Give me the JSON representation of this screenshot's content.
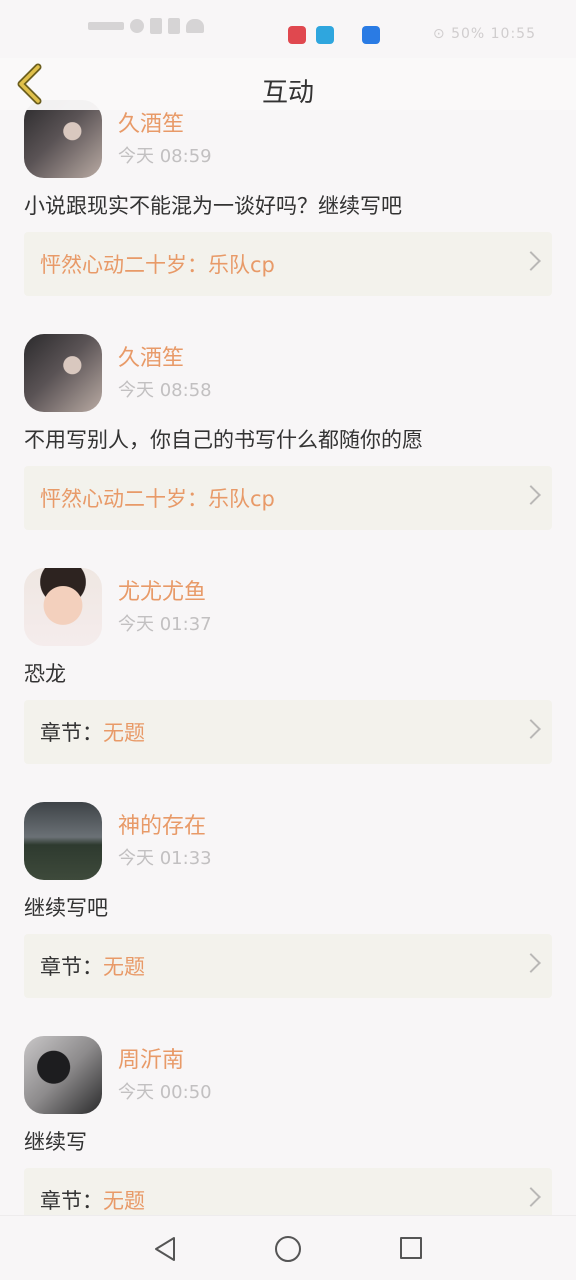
{
  "header": {
    "title": "互动"
  },
  "status_bar": {
    "right_text": "⊙ 50% 10:55"
  },
  "comments": [
    {
      "username": "久酒笙",
      "time": "今天 08:59",
      "text": "小说跟现实不能混为一谈好吗？继续写吧",
      "ref_prefix": "",
      "ref_title": "怦然心动二十岁：乐队cp",
      "avatar": "avatar-dark-hair"
    },
    {
      "username": "久酒笙",
      "time": "今天 08:58",
      "text": "不用写别人，你自己的书写什么都随你的愿",
      "ref_prefix": "",
      "ref_title": "怦然心动二十岁：乐队cp",
      "avatar": "avatar-dark-hair"
    },
    {
      "username": "尤尤尤鱼",
      "time": "今天 01:37",
      "text": "恐龙",
      "ref_prefix": "章节：",
      "ref_title": "无题",
      "avatar": "avatar-child"
    },
    {
      "username": "神的存在",
      "time": "今天 01:33",
      "text": "继续写吧",
      "ref_prefix": "章节：",
      "ref_title": "无题",
      "avatar": "avatar-landscape"
    },
    {
      "username": "周沂南",
      "time": "今天 00:50",
      "text": "继续写",
      "ref_prefix": "章节：",
      "ref_title": "无题",
      "avatar": "avatar-monochrome"
    }
  ],
  "colors": {
    "accent": "#e89a68",
    "card_bg": "#f3f2ec",
    "background": "#f8f6f7",
    "back_icon": "#c9a227"
  },
  "icons": {
    "back": "chevron-left-icon",
    "card_arrow": "chevron-right-icon",
    "nav_back": "triangle-back-icon",
    "nav_home": "circle-home-icon",
    "nav_recent": "square-recent-icon"
  }
}
